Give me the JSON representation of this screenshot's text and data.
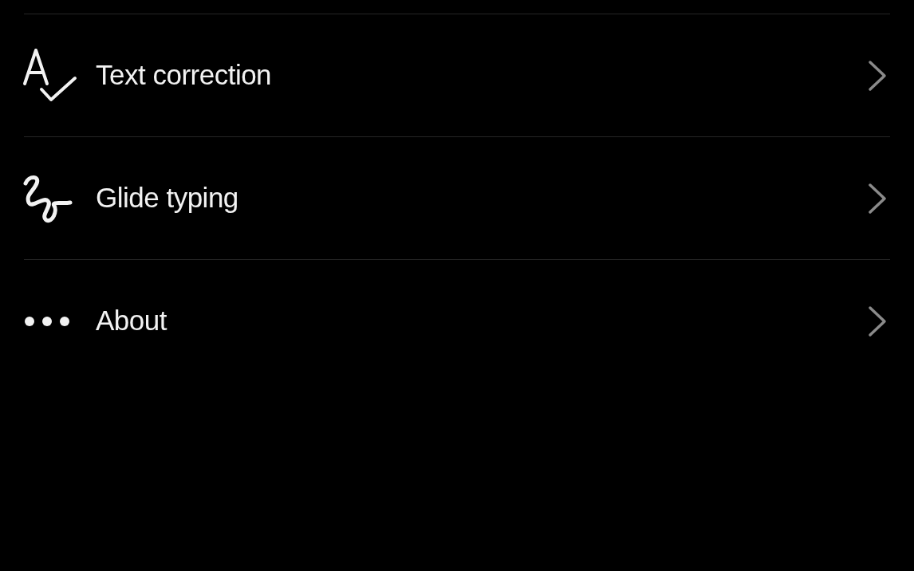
{
  "settings_list": [
    {
      "label": "Text correction"
    },
    {
      "label": "Glide typing"
    },
    {
      "label": "About"
    }
  ]
}
